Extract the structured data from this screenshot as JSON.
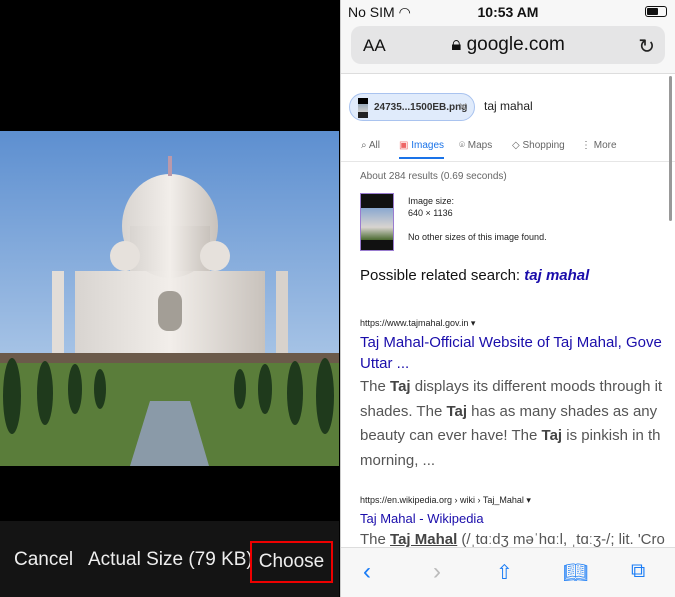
{
  "picker": {
    "cancel": "Cancel",
    "actual_size": "Actual Size (79 KB)",
    "choose": "Choose",
    "highlight_color": "#e00000"
  },
  "status": {
    "carrier": "No SIM",
    "time": "10:53 AM"
  },
  "browser": {
    "text_size": "AA",
    "url": "google.com",
    "icons": [
      "lock-icon",
      "reload-icon"
    ]
  },
  "search": {
    "chip_file": "24735...1500EB.png",
    "query": "taj mahal"
  },
  "tabs": [
    {
      "label": "All"
    },
    {
      "label": "Images",
      "active": true
    },
    {
      "label": "Maps"
    },
    {
      "label": "Shopping"
    },
    {
      "label": "More"
    }
  ],
  "results": {
    "stats": "About 284 results (0.69 seconds)",
    "image_size_label": "Image size:",
    "image_size": "640 × 1136",
    "no_other": "No other sizes of this image found.",
    "related_prefix": "Possible related search:",
    "related_term": "taj mahal",
    "items": [
      {
        "cite": "https://www.tajmahal.gov.in ▾",
        "title1": "Taj Mahal-Official Website of Taj Mahal, Gove",
        "title2": "Uttar ...",
        "snippet": [
          "The <b>Taj</b> displays its different moods through it",
          "shades. The <b>Taj</b> has as many shades as any",
          "beauty can ever have! The <b>Taj</b> is pinkish in th",
          "morning, ..."
        ]
      },
      {
        "cite": "https://en.wikipedia.org › wiki › Taj_Mahal ▾",
        "title1": "Taj Mahal - Wikipedia",
        "snippet": [
          "The <b><u>Taj Mahal</u></b> (/ˌtɑːdʒ məˈhɑːl, ˌtɑːʒ-/; lit. 'Cro"
        ]
      }
    ]
  },
  "accent": "#1a73e8",
  "link_color": "#1a0dab"
}
